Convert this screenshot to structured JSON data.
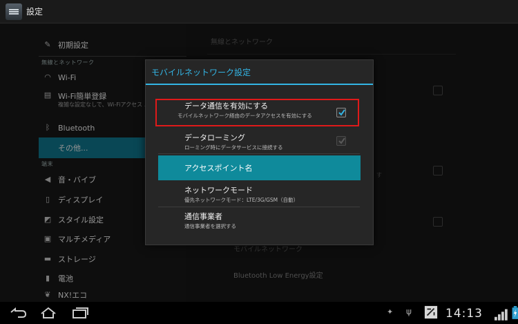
{
  "window": {
    "title": "設定"
  },
  "sidebar": {
    "items": [
      {
        "label": "初期設定"
      },
      {
        "label": "Wi-Fi"
      },
      {
        "label": "Wi-Fi簡単登録",
        "sub": "複雑な設定なしで、Wi-Fiアクセス ... 続します"
      },
      {
        "label": "Bluetooth"
      },
      {
        "label": "その他..."
      },
      {
        "label": "音・バイブ"
      },
      {
        "label": "ディスプレイ"
      },
      {
        "label": "スタイル設定"
      },
      {
        "label": "マルチメディア"
      },
      {
        "label": "ストレージ"
      },
      {
        "label": "電池"
      },
      {
        "label": "NX!エコ"
      }
    ],
    "headers": {
      "wireless": "無線とネットワーク",
      "device": "端末"
    }
  },
  "rightpane": {
    "header": "無線とネットワーク",
    "item_mobile_network": "モバイルネットワーク",
    "item_ble": "Bluetooth Low Energy設定",
    "partial_sub": "す"
  },
  "dialog": {
    "title": "モバイルネットワーク設定",
    "options": [
      {
        "title": "データ通信を有効にする",
        "sub": "モバイルネットワーク経由のデータアクセスを有効にする",
        "checked": true
      },
      {
        "title": "データローミング",
        "sub": "ローミング時にデータサービスに接続する",
        "checked": true
      },
      {
        "title": "アクセスポイント名"
      },
      {
        "title": "ネットワークモード",
        "sub": "優先ネットワークモード：LTE/3G/GSM（自動）"
      },
      {
        "title": "通信事業者",
        "sub": "通信事業者を選択する"
      }
    ]
  },
  "statusbar": {
    "clock": "14:13"
  },
  "colors": {
    "accent": "#33b5e5",
    "selected": "#0e6d83",
    "highlight": "#e01a1a"
  }
}
